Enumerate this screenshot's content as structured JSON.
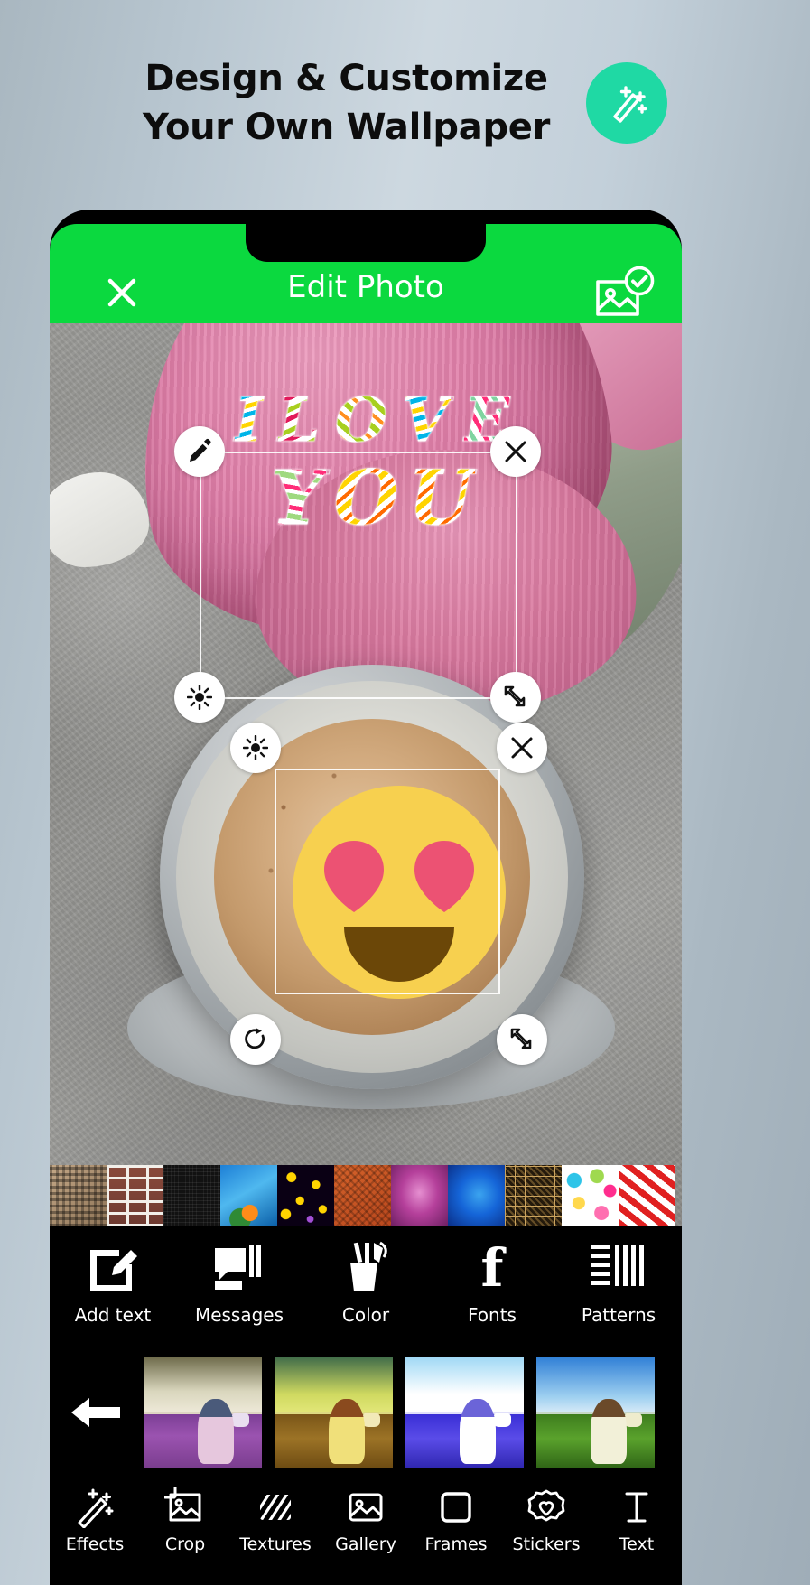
{
  "promo": {
    "line1": "Design & Customize",
    "line2": "Your Own Wallpaper",
    "badge_icon": "magic-wand-icon",
    "badge_color": "#1fd9a4"
  },
  "app": {
    "accent_color": "#0bd93f",
    "appbar": {
      "title": "Edit Photo",
      "close_icon": "close-icon",
      "save_icon": "save-image-check-icon"
    }
  },
  "canvas": {
    "text_sticker": {
      "line1": "I LOVE",
      "line2": "YOU",
      "chars1": [
        "I",
        "L",
        "O",
        "V",
        "E"
      ],
      "chars2": [
        "Y",
        "O",
        "U"
      ],
      "handles": [
        {
          "name": "edit-handle",
          "icon": "pencil-icon"
        },
        {
          "name": "delete-handle",
          "icon": "close-icon"
        },
        {
          "name": "brightness-handle",
          "icon": "brightness-icon"
        },
        {
          "name": "resize-handle",
          "icon": "resize-arrows-icon"
        }
      ]
    },
    "emoji_sticker": {
      "emoji": "heart-eyes-face",
      "face_color": "#f7d04f",
      "heart_color": "#ec5273",
      "mouth_color": "#6b4708",
      "handles": [
        {
          "name": "brightness-handle",
          "icon": "brightness-icon"
        },
        {
          "name": "delete-handle",
          "icon": "close-icon"
        },
        {
          "name": "rotate-handle",
          "icon": "rotate-icon"
        },
        {
          "name": "resize-handle",
          "icon": "resize-arrows-icon"
        }
      ]
    }
  },
  "texture_strip": {
    "items": [
      {
        "name": "texture-burlap",
        "class": "tex-burlap"
      },
      {
        "name": "texture-brick",
        "class": "tex-brick"
      },
      {
        "name": "texture-black-mesh",
        "class": "tex-black"
      },
      {
        "name": "texture-tropical",
        "class": "tex-tropic"
      },
      {
        "name": "texture-stars",
        "class": "tex-stars"
      },
      {
        "name": "texture-leather",
        "class": "tex-leather"
      },
      {
        "name": "texture-magenta-glow",
        "class": "tex-magenta"
      },
      {
        "name": "texture-blue-glow",
        "class": "tex-blue"
      },
      {
        "name": "texture-gold-grid",
        "class": "tex-goldgrid"
      },
      {
        "name": "texture-hearts",
        "class": "tex-hearts"
      },
      {
        "name": "texture-red-stripes",
        "class": "tex-stripe"
      }
    ]
  },
  "text_toolbar": {
    "items": [
      {
        "label": "Add text",
        "icon": "add-text-icon",
        "name": "tool-add-text"
      },
      {
        "label": "Messages",
        "icon": "messages-icon",
        "name": "tool-messages"
      },
      {
        "label": "Color",
        "icon": "color-icon",
        "name": "tool-color"
      },
      {
        "label": "Fonts",
        "icon": "fonts-icon",
        "name": "tool-fonts"
      },
      {
        "label": "Patterns",
        "icon": "patterns-icon",
        "name": "tool-patterns"
      }
    ]
  },
  "filter_strip": {
    "back_icon": "arrow-left-icon",
    "filters": [
      {
        "name": "filter-purple",
        "class": "f1"
      },
      {
        "name": "filter-sepia-yellow",
        "class": "f2"
      },
      {
        "name": "filter-blue-bright",
        "class": "f3"
      },
      {
        "name": "filter-green-natural",
        "class": "f4"
      }
    ]
  },
  "bottom_nav": {
    "items": [
      {
        "label": "Effects",
        "icon": "magic-wand-icon",
        "name": "nav-effects"
      },
      {
        "label": "Crop",
        "icon": "crop-image-icon",
        "name": "nav-crop"
      },
      {
        "label": "Textures",
        "icon": "diagonal-lines-icon",
        "name": "nav-textures"
      },
      {
        "label": "Gallery",
        "icon": "gallery-image-icon",
        "name": "nav-gallery"
      },
      {
        "label": "Frames",
        "icon": "square-frame-icon",
        "name": "nav-frames"
      },
      {
        "label": "Stickers",
        "icon": "heart-badge-icon",
        "name": "nav-stickers"
      },
      {
        "label": "Text",
        "icon": "text-cursor-icon",
        "name": "nav-text"
      }
    ]
  }
}
